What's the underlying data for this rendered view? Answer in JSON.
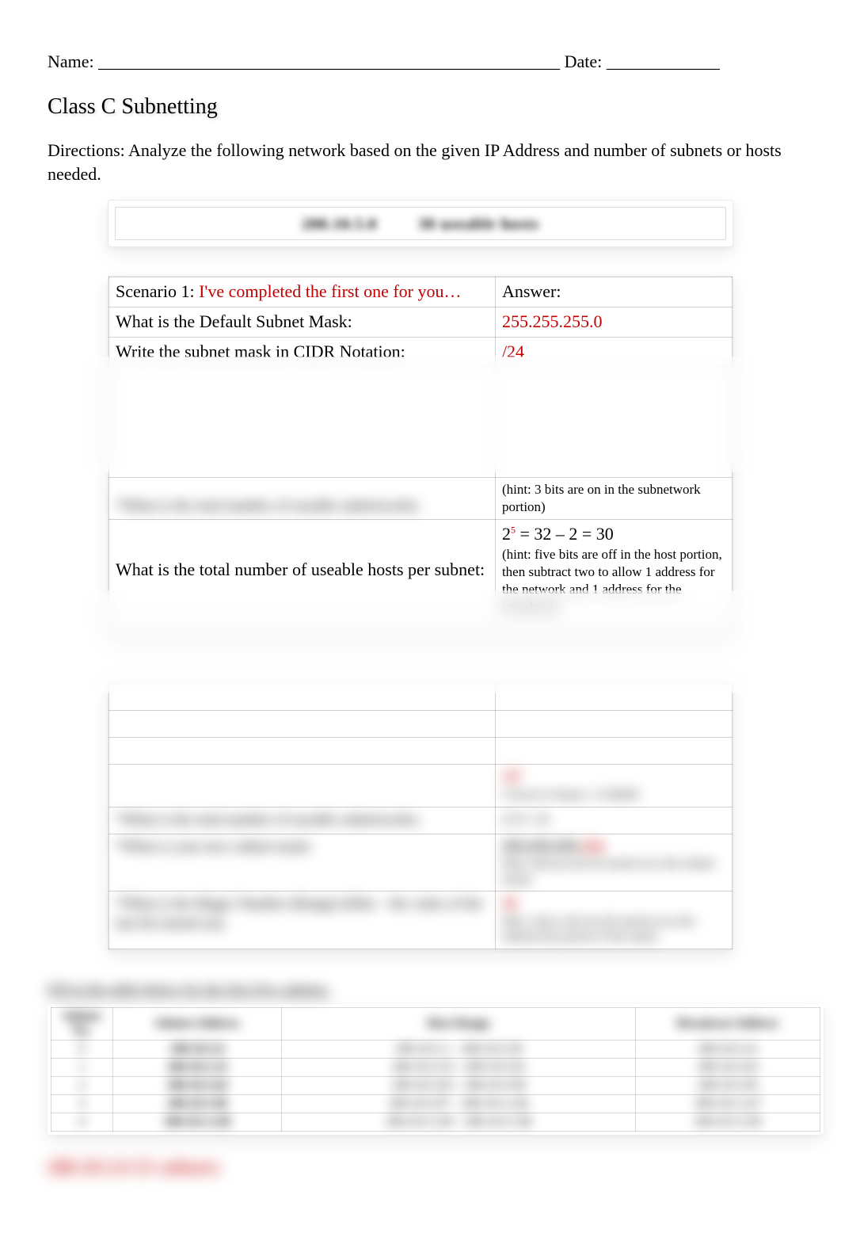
{
  "header": {
    "name_label": "Name:",
    "name_blank": " _____________________________________________________ ",
    "date_label": "Date:",
    "date_blank": " _____________"
  },
  "title": "Class C Subnetting",
  "directions": "Directions:  Analyze the following network based on the given IP Address and number of subnets or hosts needed.",
  "given": {
    "ip_blur": "200.10.5.0",
    "req_blur": "30 useable hosts"
  },
  "scenario1": {
    "rows": [
      {
        "q": "Scenario 1:  ",
        "q_red": "I've completed the first one for you…",
        "a_label": "Answer:"
      },
      {
        "q": "What is the Default Subnet Mask:",
        "a_red": "255.255.255.0"
      },
      {
        "q": "Write the subnet mask in CIDR Notation:",
        "a_red": "/24"
      }
    ],
    "hidden_rows": [
      {
        "q": "*What is the total number of useable subnetworks:",
        "a_hint": "(hint: 3 bits are on in the subnetwork portion)"
      },
      {
        "q": "What is the total number of useable hosts per subnet:",
        "a_formula_pre": "2",
        "a_formula_sup": "5",
        "a_formula_post": " = 32 – 2 = 30",
        "a_hint": "(hint: five bits are off in the host portion, then subtract two to allow 1 address for the network and 1 address for the broadcast)"
      }
    ]
  },
  "scenario2_blur": {
    "star_q": "*What is the total number of useable subnetworks:",
    "mask_q": "*What is your new subnet mask:",
    "magic_q": "*What is the Magic Number (Range) (Hint – the value of the last bit turned on):",
    "mask_a_prefix": "255.255.255.",
    "mask_a_red": "224",
    "mask_hint": "(hint: add up each bit turned on in the subnet mask)",
    "magic_a": "32",
    "magic_hint": "(hint: what is the last bit turned on in the subnetwork portion of the mask)",
    "custom_line": "Convert to binary: 11100000",
    "sup6": "2^3 = 8"
  },
  "subnet_table": {
    "caption": "Fill in the table below for the first five subnets.",
    "headers": [
      "Subnet No.",
      "Subnet Address",
      "Host Range",
      "Broadcast Address"
    ],
    "rows": [
      [
        "0",
        "200.10.5.0",
        "200.10.5.1 – 200.10.5.30",
        "200.10.5.31"
      ],
      [
        "1",
        "200.10.5.32",
        "200.10.5.33 – 200.10.5.62",
        "200.10.5.63"
      ],
      [
        "2",
        "200.10.5.64",
        "200.10.5.65 – 200.10.5.94",
        "200.10.5.95"
      ],
      [
        "3",
        "200.10.5.96",
        "200.10.5.97 – 200.10.5.126",
        "200.10.5.127"
      ],
      [
        "4",
        "200.10.5.128",
        "200.10.5.129 – 200.10.5.158",
        "200.10.5.159"
      ]
    ]
  },
  "footer_red": "200.10.5.0   25 subnets"
}
